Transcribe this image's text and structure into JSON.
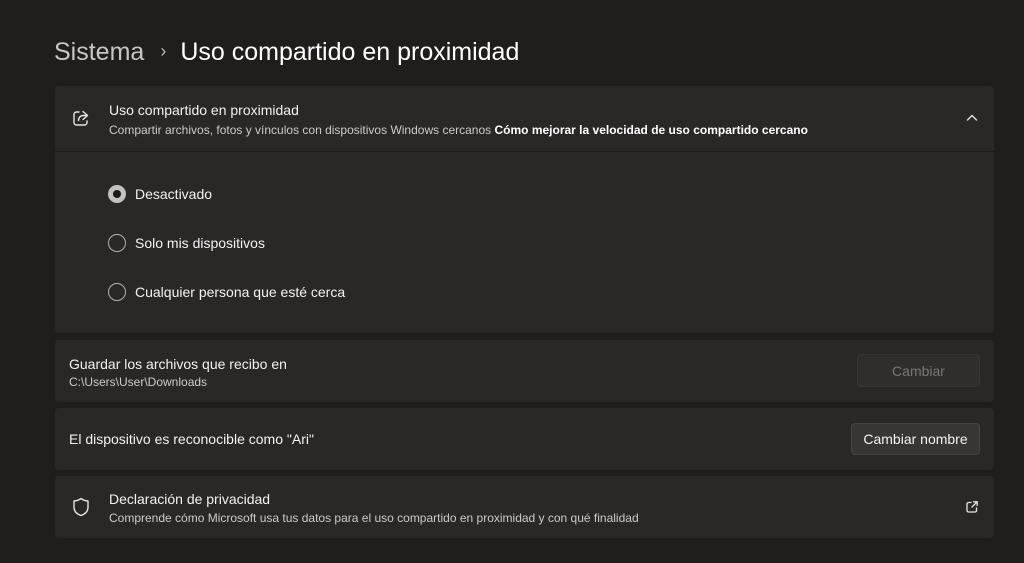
{
  "breadcrumb": {
    "parent": "Sistema",
    "separator": "›",
    "current": "Uso compartido en proximidad"
  },
  "nearby_sharing": {
    "icon": "share-icon",
    "title": "Uso compartido en proximidad",
    "description": "Compartir archivos, fotos y vínculos con dispositivos Windows cercanos",
    "link": "Cómo mejorar la velocidad de uso compartido cercano",
    "expanded": true,
    "options": [
      {
        "label": "Desactivado",
        "selected": true
      },
      {
        "label": "Solo mis dispositivos",
        "selected": false
      },
      {
        "label": "Cualquier persona que esté cerca",
        "selected": false
      }
    ]
  },
  "save_location": {
    "title": "Guardar los archivos que recibo en",
    "path": "C:\\Users\\User\\Downloads",
    "button": "Cambiar"
  },
  "device_name": {
    "title": "El dispositivo es reconocible como \"Ari\"",
    "button": "Cambiar nombre"
  },
  "privacy": {
    "icon": "shield-icon",
    "title": "Declaración de privacidad",
    "description": "Comprende cómo Microsoft usa tus datos para el uso compartido en proximidad y con qué finalidad"
  },
  "colors": {
    "background": "#221d1d",
    "card": "#2c2727"
  }
}
